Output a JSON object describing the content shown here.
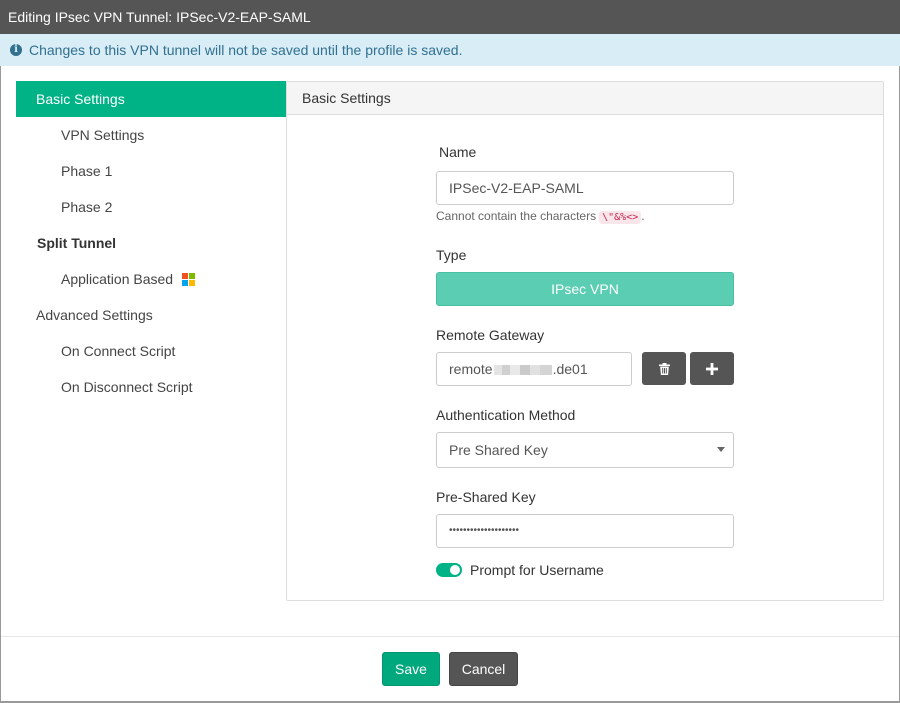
{
  "window": {
    "title": "Editing IPsec VPN Tunnel: IPSec-V2-EAP-SAML"
  },
  "notice": {
    "text": "Changes to this VPN tunnel will not be saved until the profile is saved.",
    "icon": "info-circle-icon"
  },
  "sidebar": {
    "items": [
      {
        "label": "Basic Settings"
      },
      {
        "label": "VPN Settings"
      },
      {
        "label": "Phase 1"
      },
      {
        "label": "Phase 2"
      },
      {
        "label": "Split Tunnel"
      },
      {
        "label": "Application Based"
      },
      {
        "label": "Advanced Settings"
      },
      {
        "label": "On Connect Script"
      },
      {
        "label": "On Disconnect Script"
      }
    ]
  },
  "panel": {
    "title": "Basic Settings",
    "name": {
      "label": "Name",
      "value": "IPSec-V2-EAP-SAML",
      "help": "Cannot contain the characters",
      "forbidden": "\\\"&%<>",
      "help_end": "."
    },
    "type": {
      "label": "Type",
      "value": "IPsec VPN"
    },
    "gateway": {
      "label": "Remote Gateway",
      "value_prefix": "remote",
      "value_suffix": ".de01"
    },
    "auth": {
      "label": "Authentication Method",
      "value": "Pre Shared Key"
    },
    "psk": {
      "label": "Pre-Shared Key",
      "value": "••••••••••••••••••••"
    },
    "prompt": {
      "label": "Prompt for Username",
      "enabled": true
    }
  },
  "footer": {
    "save": "Save",
    "cancel": "Cancel"
  },
  "colors": {
    "accent": "#00b386",
    "titlebar": "#555555",
    "notice_bg": "#d9edf7"
  }
}
